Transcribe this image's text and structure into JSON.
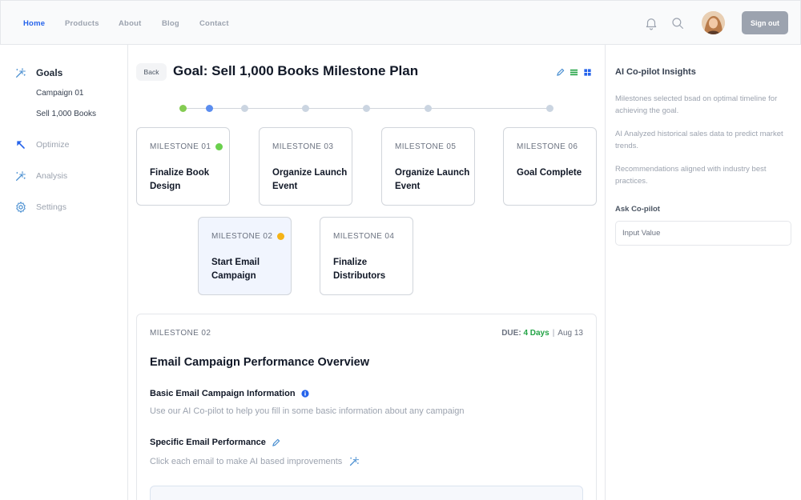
{
  "nav": {
    "items": [
      {
        "label": "Home",
        "active": true
      },
      {
        "label": "Products",
        "active": false
      },
      {
        "label": "About",
        "active": false
      },
      {
        "label": "Blog",
        "active": false
      },
      {
        "label": "Contact",
        "active": false
      }
    ],
    "icons": [
      "bell-icon",
      "search-icon"
    ],
    "signout_label": "Sign out"
  },
  "sidebar": {
    "goals_label": "Goals",
    "sub_items": [
      "Campaign 01",
      "Sell 1,000 Books"
    ],
    "items": [
      {
        "label": "Optimize",
        "icon": "arrow-up-left-icon"
      },
      {
        "label": "Analysis",
        "icon": "magic-wand-icon"
      },
      {
        "label": "Settings",
        "icon": "gear-icon"
      }
    ]
  },
  "header": {
    "back_label": "Back",
    "title": "Goal: Sell 1,000 Books Milestone Plan",
    "tools": [
      "pencil-icon",
      "list-icon",
      "grid-icon"
    ]
  },
  "timeline_dots": [
    "#84cc52",
    "#5b8def",
    "#cbd5e1",
    "#cbd5e1",
    "#cbd5e1",
    "#cbd5e1",
    "#cbd5e1"
  ],
  "milestones": [
    {
      "label": "MILESTONE 01",
      "title": "Finalize Book Design",
      "status_color": "#6ad04d"
    },
    {
      "label": "MILESTONE 02",
      "title": "Start Email Campaign",
      "status_color": "#f5b316"
    },
    {
      "label": "MILESTONE 03",
      "title": "Organize Launch Event",
      "status_color": ""
    },
    {
      "label": "MILESTONE 04",
      "title": "Finalize Distributors",
      "status_color": ""
    },
    {
      "label": "MILESTONE 05",
      "title": "Organize Launch Event",
      "status_color": ""
    },
    {
      "label": "MILESTONE 06",
      "title": "Goal Complete",
      "status_color": ""
    }
  ],
  "detail": {
    "milestone": "MILESTONE 02",
    "due_label": "DUE:",
    "due_days": "4 Days",
    "due_date": "Aug 13",
    "title": "Email Campaign Performance Overview",
    "section1_heading": "Basic Email Campaign Information",
    "section1_text": "Use our AI Co-pilot to help you fill in some basic information about any campaign",
    "section2_heading": "Specific Email Performance",
    "section2_text": "Click each email to make AI based improvements"
  },
  "copilot": {
    "title": "AI Co-pilot Insights",
    "insights": [
      "Milestones selected bsad on optimal timeline for achieving the goal.",
      "AI Analyzed historical sales data to predict market trends.",
      "Recommendations aligned with industry best practices."
    ],
    "ask_label": "Ask Co-pilot",
    "input_placeholder": "Input Value"
  },
  "colors": {
    "accent": "#2563eb",
    "sidebar_icon": "#4a8fd1",
    "due_green": "#22a345"
  }
}
